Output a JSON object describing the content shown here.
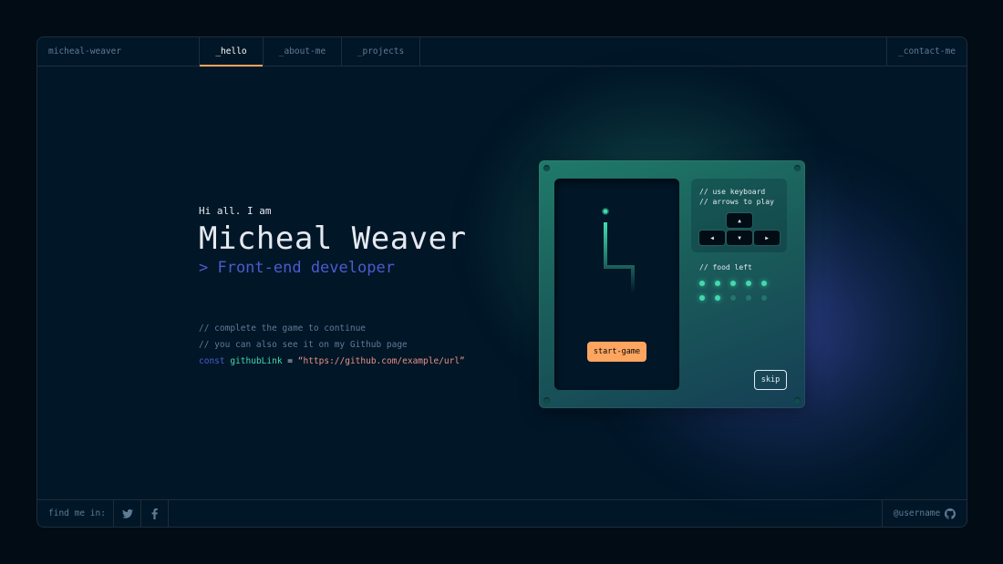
{
  "header": {
    "brand": "micheal-weaver",
    "tabs": [
      {
        "label": "_hello",
        "active": true
      },
      {
        "label": "_about-me",
        "active": false
      },
      {
        "label": "_projects",
        "active": false
      }
    ],
    "contact": "_contact-me"
  },
  "hero": {
    "greeting": "Hi all. I am",
    "name": "Micheal Weaver",
    "role": "> Front-end developer",
    "comment1": "// complete the game to continue",
    "comment2": "// you can also see it on my Github page",
    "code": {
      "keyword": "const",
      "variable": "githubLink",
      "equals": "=",
      "string": "“https://github.com/example/url”"
    }
  },
  "game": {
    "start_label": "start-game",
    "instructions": "// use keyboard\n// arrows to play",
    "food_label": "// food left",
    "food_total": 10,
    "food_remaining": 7,
    "skip_label": "skip",
    "keys": {
      "up": "▲",
      "left": "◀",
      "down": "▼",
      "right": "▶"
    }
  },
  "footer": {
    "find_label": "find me in:",
    "social": [
      "twitter-icon",
      "facebook-icon"
    ],
    "github_label": "@username"
  },
  "colors": {
    "background": "#011627",
    "accent_orange": "#fea55f",
    "accent_green": "#43d9ad",
    "accent_blue": "#4d5bce",
    "string_pink": "#e99287",
    "muted": "#607b96"
  }
}
